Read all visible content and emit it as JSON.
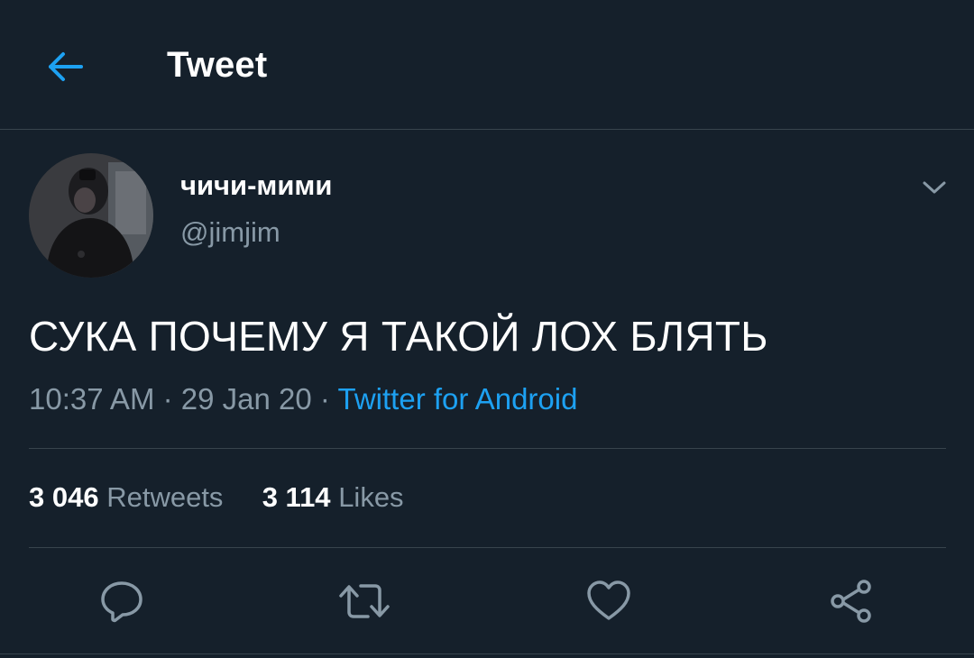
{
  "header": {
    "title": "Tweet",
    "back_icon": "arrow-left-icon"
  },
  "tweet": {
    "display_name": "чичи-мими",
    "handle": "@jimjim",
    "text": "СУКА ПОЧЕМУ Я ТАКОЙ ЛОХ БЛЯТЬ",
    "time": "10:37 AM",
    "date": "29 Jan 20",
    "separator": "·",
    "source": "Twitter for Android",
    "retweets_count": "3 046",
    "retweets_label": "Retweets",
    "likes_count": "3 114",
    "likes_label": "Likes"
  },
  "actions": [
    "reply-icon",
    "retweet-icon",
    "like-icon",
    "share-icon"
  ],
  "colors": {
    "background": "#15202b",
    "accent": "#1da1f2",
    "secondary_text": "#8899a6",
    "divider": "#38444d"
  }
}
